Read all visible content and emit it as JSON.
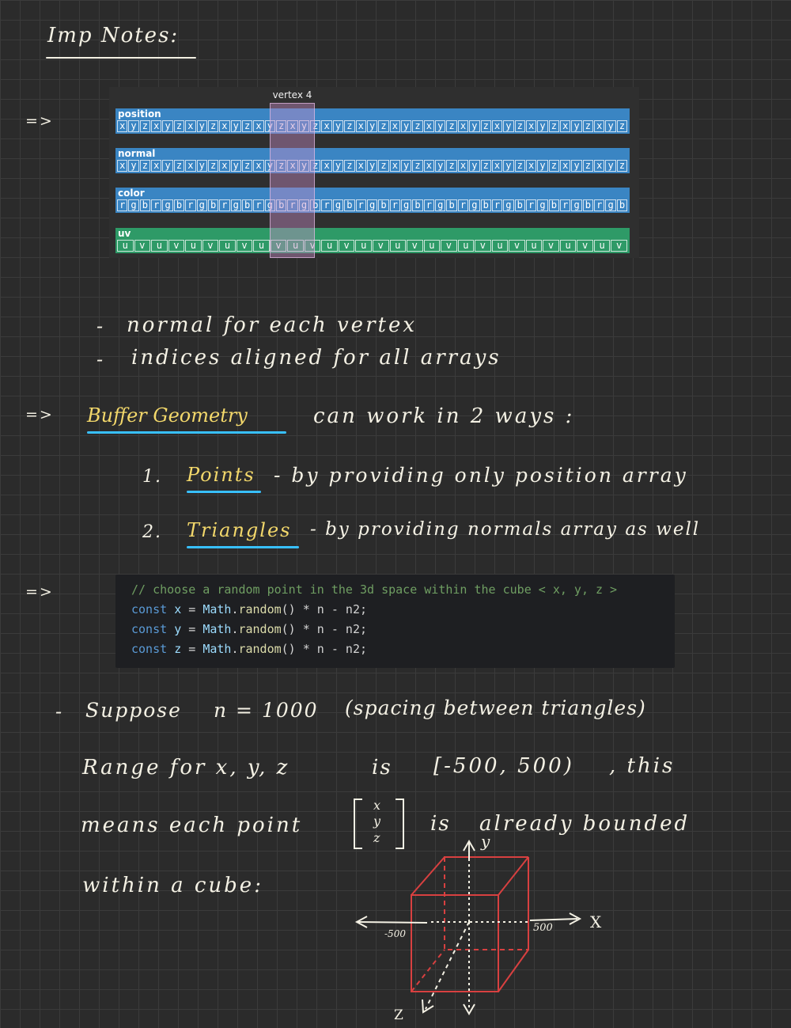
{
  "title": "Imp Notes:",
  "arrow_symbol": "=>",
  "buffers": {
    "vertex_label": "vertex 4",
    "rows": [
      {
        "label": "position",
        "color": "#3a85c3",
        "cells": [
          "x",
          "y",
          "z",
          "x",
          "y",
          "z",
          "x",
          "y",
          "z",
          "x",
          "y",
          "z",
          "x",
          "y",
          "z",
          "x",
          "y",
          "z",
          "x",
          "y",
          "z",
          "x",
          "y",
          "z",
          "x",
          "y",
          "z",
          "x",
          "y",
          "z",
          "x",
          "y",
          "z",
          "x",
          "y",
          "z",
          "x",
          "y",
          "z",
          "x",
          "y",
          "z",
          "x",
          "y",
          "z"
        ]
      },
      {
        "label": "normal",
        "color": "#3a85c3",
        "cells": [
          "x",
          "y",
          "z",
          "x",
          "y",
          "z",
          "x",
          "y",
          "z",
          "x",
          "y",
          "z",
          "x",
          "y",
          "z",
          "x",
          "y",
          "z",
          "x",
          "y",
          "z",
          "x",
          "y",
          "z",
          "x",
          "y",
          "z",
          "x",
          "y",
          "z",
          "x",
          "y",
          "z",
          "x",
          "y",
          "z",
          "x",
          "y",
          "z",
          "x",
          "y",
          "z",
          "x",
          "y",
          "z"
        ]
      },
      {
        "label": "color",
        "color": "#3a85c3",
        "cells": [
          "r",
          "g",
          "b",
          "r",
          "g",
          "b",
          "r",
          "g",
          "b",
          "r",
          "g",
          "b",
          "r",
          "g",
          "b",
          "r",
          "g",
          "b",
          "r",
          "g",
          "b",
          "r",
          "g",
          "b",
          "r",
          "g",
          "b",
          "r",
          "g",
          "b",
          "r",
          "g",
          "b",
          "r",
          "g",
          "b",
          "r",
          "g",
          "b",
          "r",
          "g",
          "b",
          "r",
          "g",
          "b"
        ]
      },
      {
        "label": "uv",
        "color": "#2e9a67",
        "cells": [
          "u",
          "v",
          "u",
          "v",
          "u",
          "v",
          "u",
          "v",
          "u",
          "v",
          "u",
          "v",
          "u",
          "v",
          "u",
          "v",
          "u",
          "v",
          "u",
          "v",
          "u",
          "v",
          "u",
          "v",
          "u",
          "v",
          "u",
          "v",
          "u",
          "v"
        ]
      }
    ]
  },
  "bullets": {
    "b1": "normal for each vertex",
    "b2": "indices aligned for all arrays"
  },
  "buffer_geometry": {
    "name": "Buffer Geometry",
    "rest": "can work in 2 ways :",
    "item1_num": "1.",
    "item1_name": "Points",
    "item1_desc": "- by providing only position array",
    "item2_num": "2.",
    "item2_name": "Triangles",
    "item2_desc": "- by providing normals array as well"
  },
  "code": {
    "comment": "// choose a random point in the 3d space within the cube < x, y, z >",
    "lines": [
      {
        "kw": "const",
        "id": "x",
        "eq": "=",
        "obj": "Math",
        "fn": "random",
        "rest": "() * n - n2;"
      },
      {
        "kw": "const",
        "id": "y",
        "eq": "=",
        "obj": "Math",
        "fn": "random",
        "rest": "() * n - n2;"
      },
      {
        "kw": "const",
        "id": "z",
        "eq": "=",
        "obj": "Math",
        "fn": "random",
        "rest": "() * n - n2;"
      }
    ]
  },
  "notes": {
    "dash": "-",
    "suppose": "Suppose",
    "n_eq": "n = 1000",
    "spacing": "(spacing between triangles)",
    "range": "Range for x, y, z",
    "is": "is",
    "interval": "[-500, 500)",
    "this": ", this",
    "means": "means each point",
    "vec_x": "x",
    "vec_y": "y",
    "vec_z": "z",
    "is2": "is",
    "bounded": "already bounded",
    "within": "within a cube:"
  },
  "diagram": {
    "axis_x": "X",
    "axis_y": "y",
    "axis_z": "Z",
    "neg": "-500",
    "pos": "500"
  }
}
